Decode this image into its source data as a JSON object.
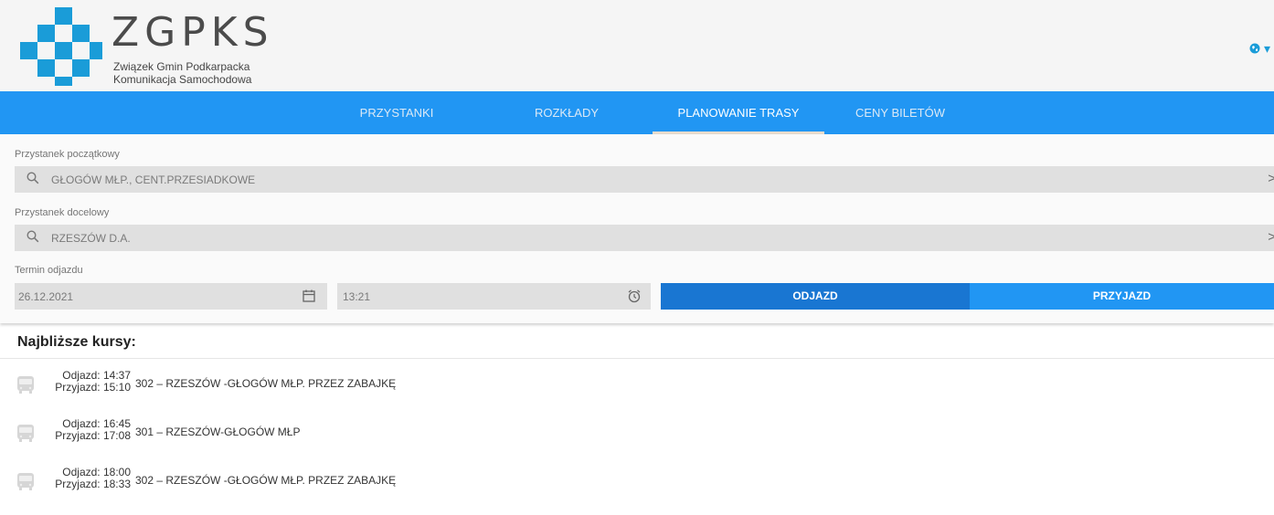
{
  "header": {
    "logo_title": "ZGPKS",
    "logo_sub1": "Związek Gmin Podkarpacka",
    "logo_sub2": "Komunikacja Samochodowa",
    "language_icon": "globe-icon",
    "language_caret": "▾"
  },
  "nav": {
    "items": [
      {
        "label": "PRZYSTANKI"
      },
      {
        "label": "ROZKŁADY"
      },
      {
        "label": "PLANOWANIE TRASY",
        "active": true
      },
      {
        "label": "CENY BILETÓW"
      }
    ]
  },
  "form": {
    "start_label": "Przystanek początkowy",
    "start_value": "GŁOGÓW MŁP., CENT.PRZESIADKOWE",
    "dest_label": "Przystanek docelowy",
    "dest_value": "RZESZÓW D.A.",
    "clear_glyph": ">",
    "date_label": "Termin odjazdu",
    "date_value": "26.12.2021",
    "time_value": "13:21",
    "depart_button": "ODJAZD",
    "arrive_button": "PRZYJAZD"
  },
  "results": {
    "title": "Najbliższe kursy:",
    "courses": [
      {
        "departure": "Odjazd: 14:37",
        "arrival": "Przyjazd: 15:10",
        "route": "302 – RZESZÓW -GŁOGÓW MŁP. PRZEZ ZABAJKĘ"
      },
      {
        "departure": "Odjazd: 16:45",
        "arrival": "Przyjazd: 17:08",
        "route": "301 – RZESZÓW-GŁOGÓW MŁP"
      },
      {
        "departure": "Odjazd: 18:00",
        "arrival": "Przyjazd: 18:33",
        "route": "302 – RZESZÓW -GŁOGÓW MŁP. PRZEZ ZABAJKĘ"
      }
    ]
  },
  "colors": {
    "nav_bg": "#2196f3",
    "brand": "#1a9cd8",
    "depart_active": "#1976d2",
    "active_underline": "#e8dccd"
  }
}
